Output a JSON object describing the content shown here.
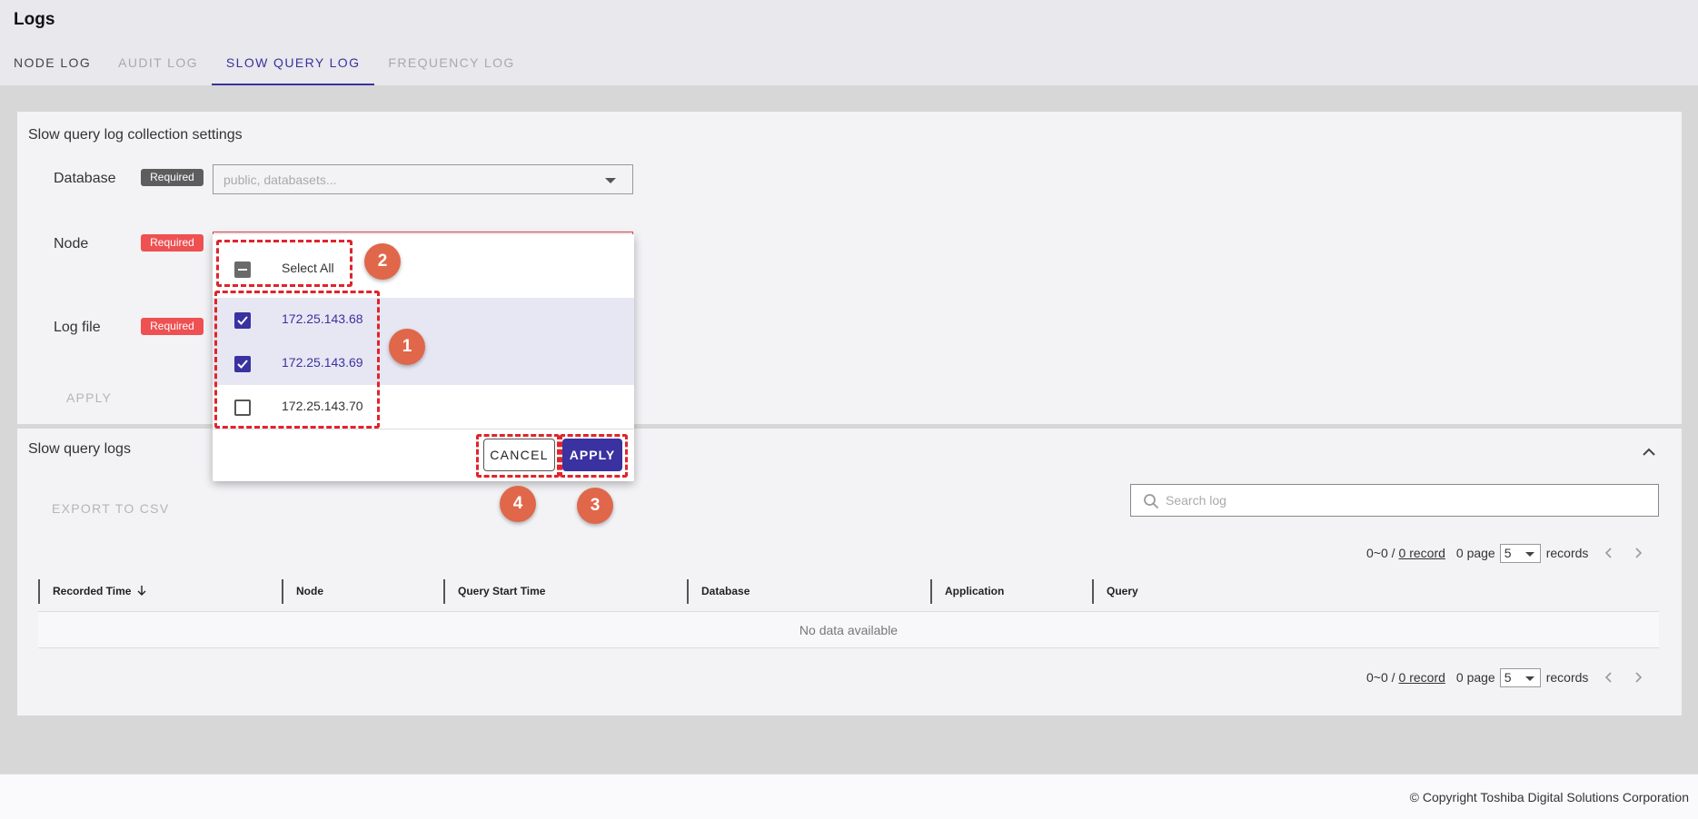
{
  "header": {
    "title": "Logs",
    "tabs": [
      {
        "label": "NODE LOG"
      },
      {
        "label": "AUDIT LOG"
      },
      {
        "label": "SLOW QUERY LOG"
      },
      {
        "label": "FREQUENCY LOG"
      }
    ]
  },
  "settings": {
    "title": "Slow query log collection settings",
    "required_badge": "Required",
    "database": {
      "label": "Database",
      "placeholder": "public, databasets..."
    },
    "node": {
      "label": "Node"
    },
    "logfile": {
      "label": "Log file"
    },
    "apply_label": "APPLY"
  },
  "node_dropdown": {
    "select_all": "Select All",
    "options": [
      {
        "label": "172.25.143.68",
        "checked": true
      },
      {
        "label": "172.25.143.69",
        "checked": true
      },
      {
        "label": "172.25.143.70",
        "checked": false
      }
    ],
    "cancel_label": "CANCEL",
    "apply_label": "APPLY"
  },
  "callouts": [
    "1",
    "2",
    "3",
    "4"
  ],
  "logs": {
    "title": "Slow query logs",
    "export_label": "EXPORT TO CSV",
    "search_placeholder": "Search log",
    "pagination": {
      "range": "0~0 /",
      "record_link": "0 record",
      "page": "0 page",
      "page_size": "5",
      "records_label": "records"
    },
    "columns": [
      "Recorded Time",
      "Node",
      "Query Start Time",
      "Database",
      "Application",
      "Query"
    ],
    "empty_text": "No data available"
  },
  "footer": {
    "copyright": "© Copyright Toshiba Digital Solutions Corporation"
  },
  "colors": {
    "accent": "#3a32a0",
    "required": "#ef5052",
    "highlight": "#e0242b",
    "callout": "#e0674a"
  }
}
